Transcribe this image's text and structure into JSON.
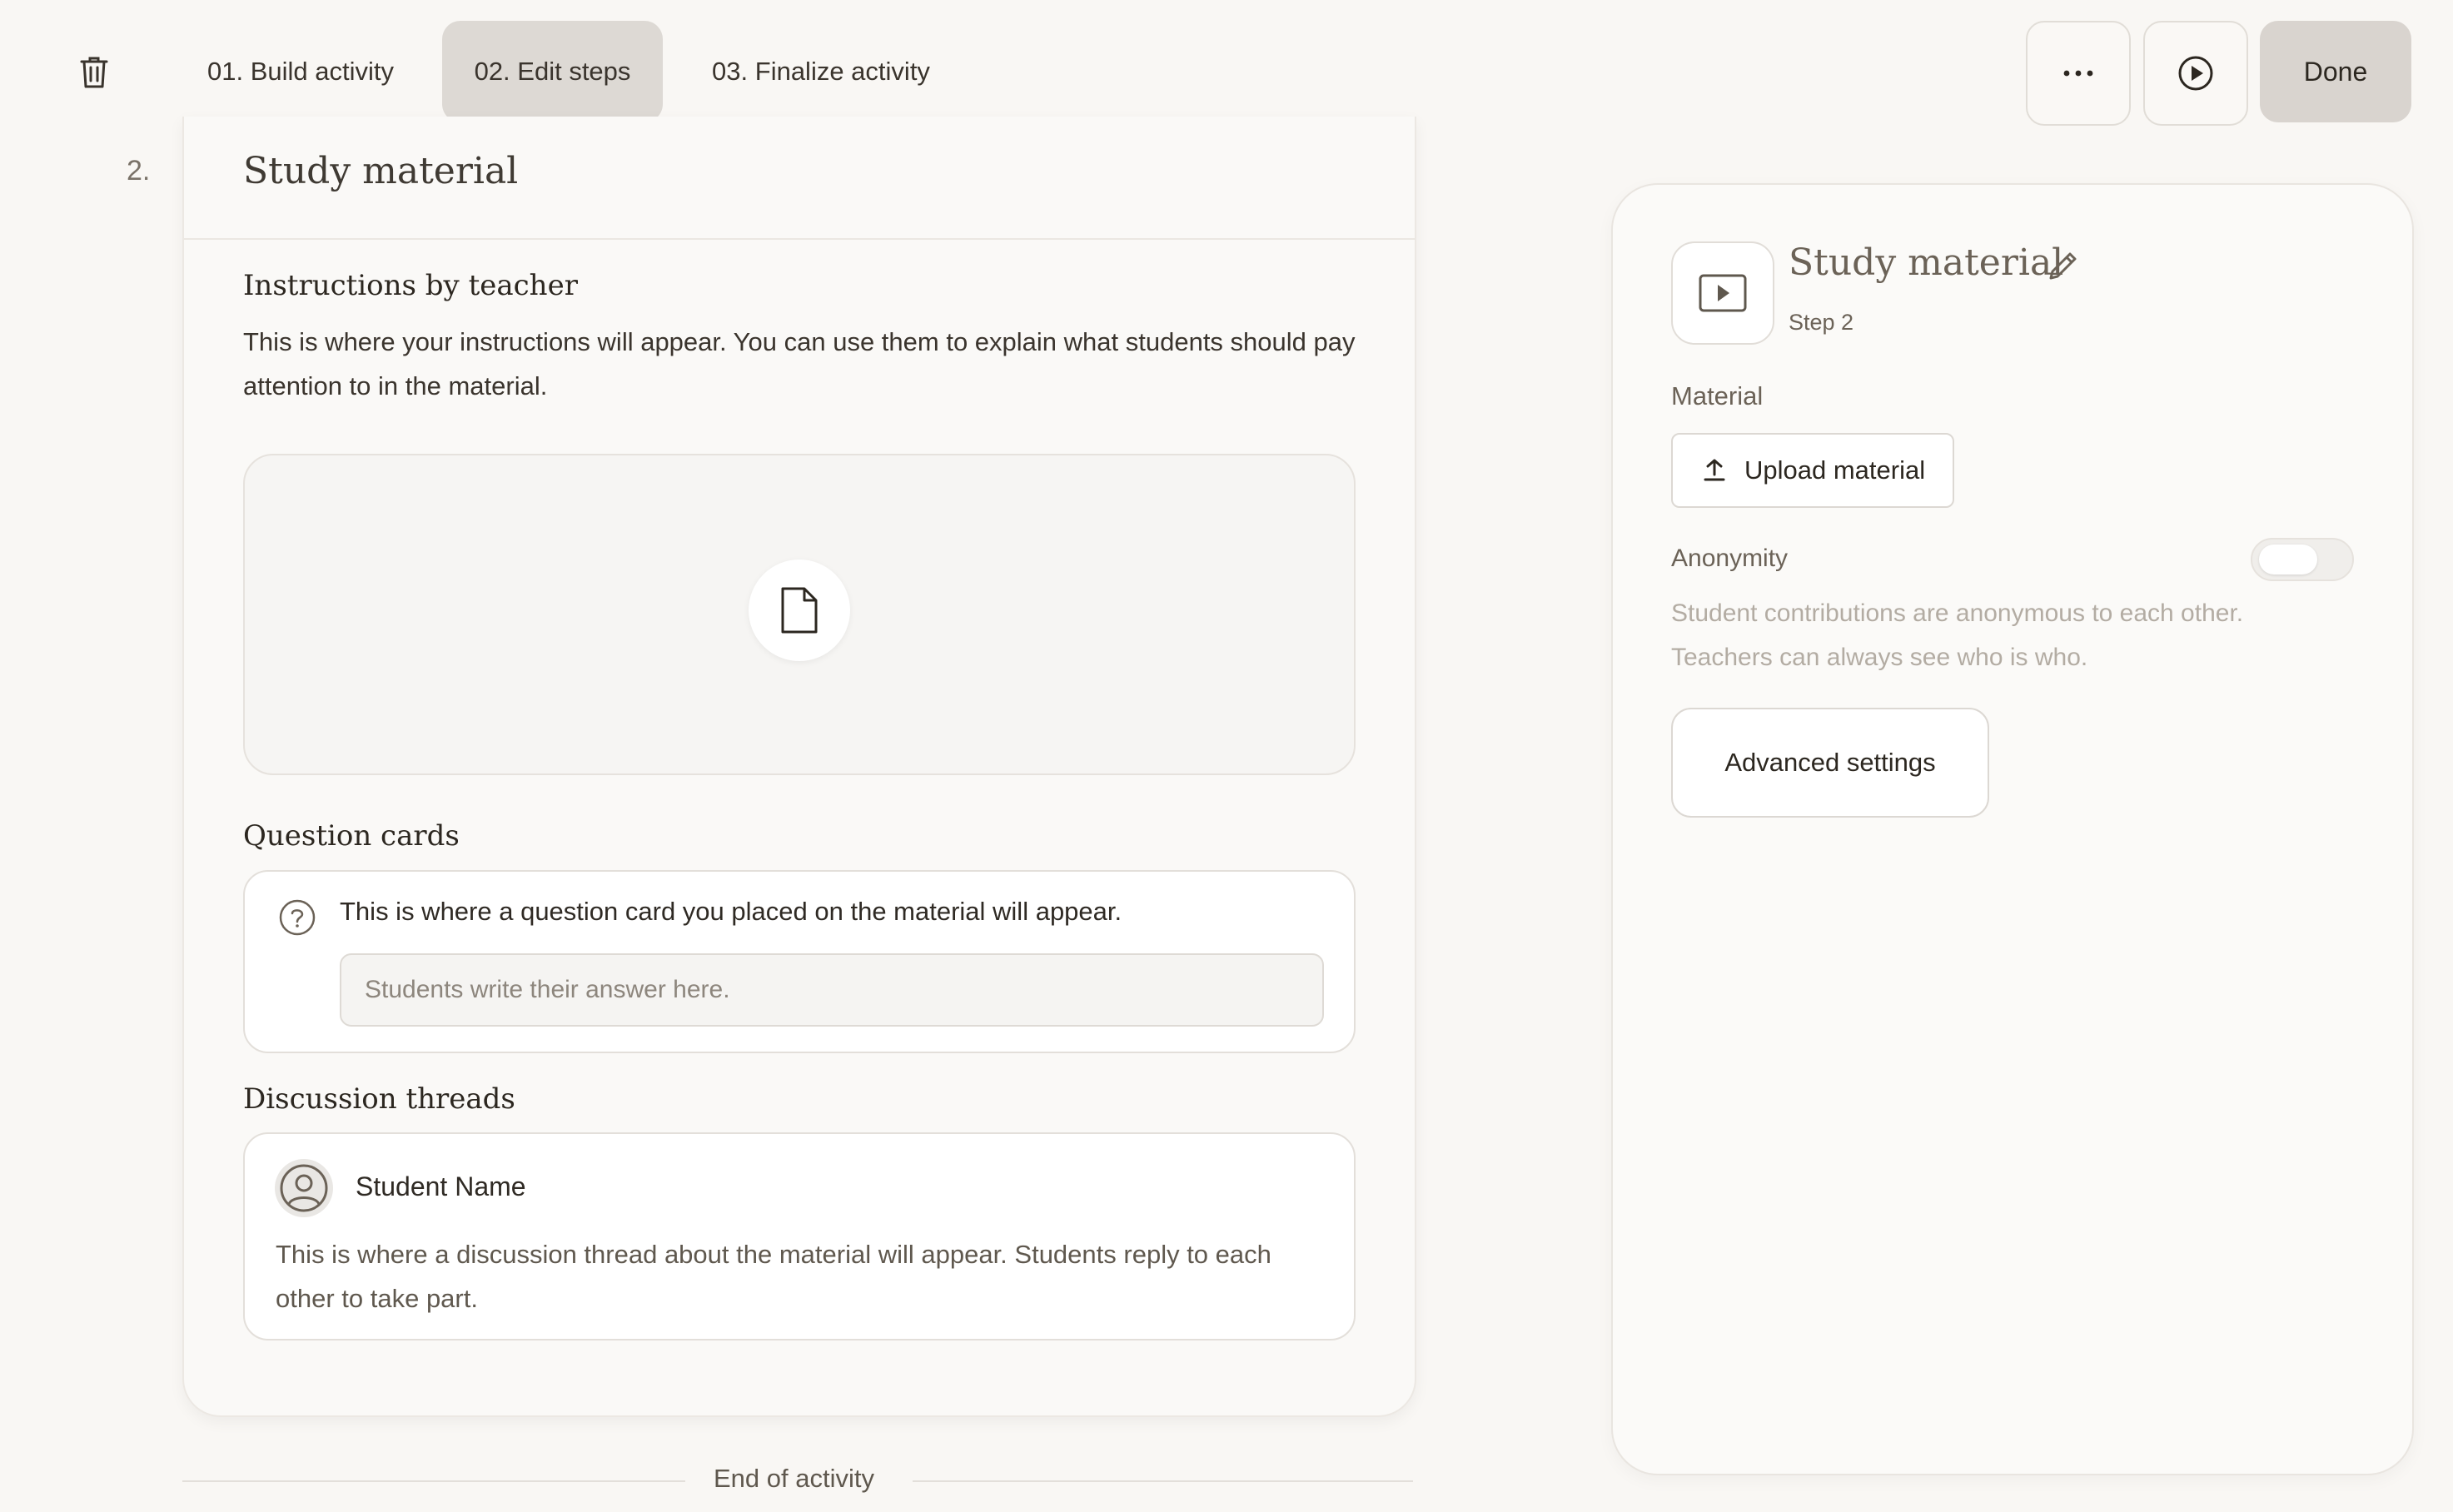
{
  "toolbar": {
    "tabs": [
      {
        "label": "01. Build activity"
      },
      {
        "label": "02. Edit steps"
      },
      {
        "label": "03. Finalize activity"
      }
    ],
    "active_tab": "02. Edit steps",
    "more_icon": "ellipsis-icon",
    "preview_icon": "play-circle-icon",
    "delete_icon": "trash-icon",
    "done_label": "Done"
  },
  "step": {
    "number": "2.",
    "title": "Study material",
    "instructions_heading": "Instructions by teacher",
    "instructions_text": "This is where your instructions will appear. You can use them to explain what students should pay attention to in the material.",
    "material_placeholder_icon": "document-icon",
    "question_cards_heading": "Question cards",
    "question_card_text": "This is where a question card you placed on the material will appear.",
    "answer_placeholder": "Students write their answer here.",
    "discussion_heading": "Discussion threads",
    "student_name": "Student Name",
    "discussion_text": "This is where a discussion thread about the material will appear. Students reply to each other to take part."
  },
  "end_label": "End of activity",
  "panel": {
    "icon": "video-play-icon",
    "title": "Study material",
    "subtitle": "Step 2",
    "material_label": "Material",
    "upload_label": "Upload material",
    "anonymity_label": "Anonymity",
    "anonymity_enabled": false,
    "anonymity_desc": "Student contributions are anonymous to each other. Teachers can always see who is who.",
    "advanced_label": "Advanced settings"
  },
  "colors": {
    "background": "#f9f7f4",
    "active_tab": "#ddd9d4",
    "done_button": "#d9d4cf",
    "muted_text": "#b3aca3"
  }
}
